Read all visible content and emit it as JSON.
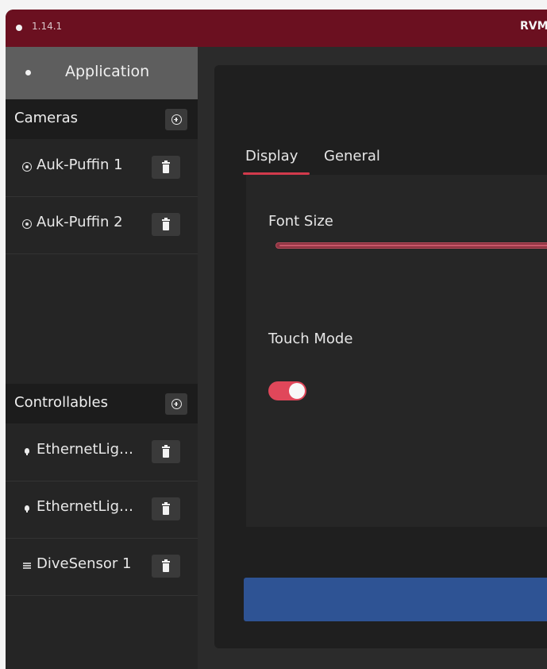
{
  "titlebar": {
    "version": "1.14.1",
    "app_name": "RVM"
  },
  "sidebar": {
    "application_label": "Application",
    "cameras": {
      "header": "Cameras",
      "items": [
        {
          "label": "Auk-Puffin 1",
          "icon": "radio-icon"
        },
        {
          "label": "Auk-Puffin 2",
          "icon": "radio-icon"
        }
      ]
    },
    "controllables": {
      "header": "Controllables",
      "items": [
        {
          "label": "EthernetLig…",
          "icon": "light-bulb-icon"
        },
        {
          "label": "EthernetLig…",
          "icon": "light-bulb-icon"
        },
        {
          "label": "DiveSensor 1",
          "icon": "sensor-icon"
        }
      ]
    }
  },
  "main": {
    "tabs": [
      {
        "label": "Display",
        "active": true
      },
      {
        "label": "General",
        "active": false
      }
    ],
    "settings": {
      "font_size_label": "Font Size",
      "touch_mode_label": "Touch Mode",
      "touch_mode_enabled": true
    }
  },
  "colors": {
    "titlebar": "#6b1020",
    "accent": "#e0475a",
    "apply_button": "#2e5394",
    "sidebar_selected": "#5e5e5e"
  }
}
